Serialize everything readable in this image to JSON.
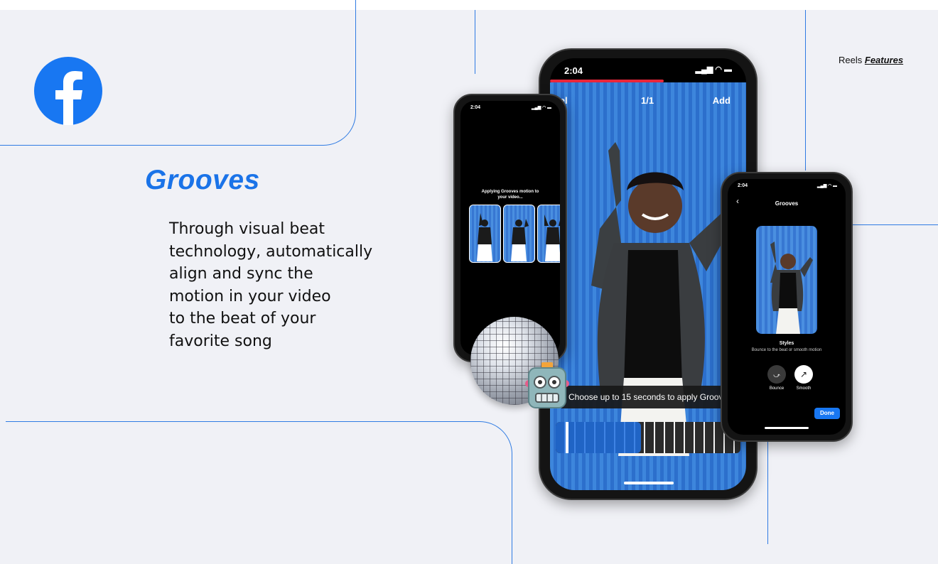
{
  "brand": {
    "logo_icon": "facebook-logo-icon",
    "accent": "#1a73e8",
    "line_color": "#2f7be3"
  },
  "header": {
    "section": "Reels",
    "subsection": "Features"
  },
  "feature": {
    "title": "Grooves",
    "description_lines": [
      "Through visual beat",
      "technology, automatically",
      "align and sync the",
      "motion in your video",
      "to the beat of your",
      "favorite song"
    ]
  },
  "main_phone": {
    "time": "2:04",
    "cancel": "Cancel",
    "counter": "1/1",
    "add": "Add",
    "toast": "Choose up to 15 seconds to apply Grooves"
  },
  "left_phone": {
    "time": "2:04",
    "status_text_line1": "Applying Grooves motion to",
    "status_text_line2": "your video..."
  },
  "right_phone": {
    "time": "2:04",
    "title": "Grooves",
    "styles_heading": "Styles",
    "styles_subtitle": "Bounce to the beat or smooth motion",
    "style_options": [
      "Bounce",
      "Smooth"
    ],
    "done": "Done"
  },
  "stickers": [
    "disco-ball-icon",
    "robot-face-icon"
  ]
}
